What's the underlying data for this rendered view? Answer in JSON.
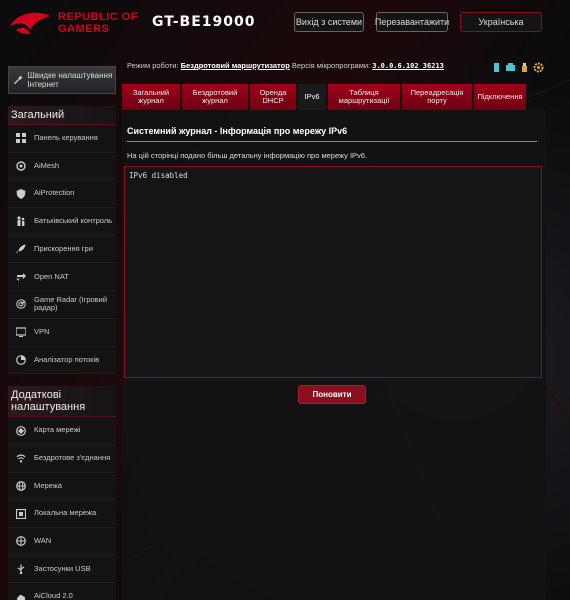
{
  "header": {
    "brand_line1": "REPUBLIC OF",
    "brand_line2": "GAMERS",
    "model": "GT-BE19000",
    "logout_label": "Вихід з системи",
    "reboot_label": "Перезавантажити",
    "language": "Українська"
  },
  "sidebar": {
    "quick_setup": "Швидке налаштування Інтернет",
    "general_title": "Загальний",
    "general_items": [
      {
        "label": "Панель керування",
        "icon": "dashboard-icon"
      },
      {
        "label": "AiMesh",
        "icon": "aimesh-icon"
      },
      {
        "label": "AiProtection",
        "icon": "shield-icon"
      },
      {
        "label": "Батьківський контроль",
        "icon": "parental-icon"
      },
      {
        "label": "Прискорення гри",
        "icon": "rocket-icon"
      },
      {
        "label": "Open NAT",
        "icon": "nat-icon"
      },
      {
        "label": "Game Radar (Ігровий радар)",
        "icon": "radar-icon"
      },
      {
        "label": "VPN",
        "icon": "vpn-icon"
      },
      {
        "label": "Аналізатор потоків",
        "icon": "traffic-icon"
      }
    ],
    "advanced_title": "Додаткові налаштування",
    "advanced_items": [
      {
        "label": "Карта мережі",
        "icon": "network-map-icon"
      },
      {
        "label": "Бездротове з'єднання",
        "icon": "wireless-icon"
      },
      {
        "label": "Мережа",
        "icon": "globe-icon"
      },
      {
        "label": "Локальна мережа",
        "icon": "lan-icon"
      },
      {
        "label": "WAN",
        "icon": "wan-icon"
      },
      {
        "label": "Застосунки USB",
        "icon": "usb-icon"
      },
      {
        "label": "AiCloud 2.0",
        "icon": "cloud-icon"
      }
    ]
  },
  "status": {
    "mode_prefix": "Режим роботи:",
    "mode_value": "Бездротовий маршрутизатор",
    "fw_prefix": "Версія мікропрограми:",
    "fw_value": "3.0.0.6.102_36213"
  },
  "tabs": [
    {
      "label": "Загальний журнал",
      "width": 58
    },
    {
      "label": "Бездротовий журнал",
      "width": 66
    },
    {
      "label": "Оренда DHCP",
      "width": 46
    },
    {
      "label": "IPv6",
      "width": 28,
      "active": true
    },
    {
      "label": "Таблиця маршрутизації",
      "width": 72
    },
    {
      "label": "Переадресація порту",
      "width": 70
    },
    {
      "label": "Підключення",
      "width": 52
    }
  ],
  "content": {
    "title": "Системний журнал - Інформація про мережу IPv6",
    "description": "На цій сторінці подано більш детальну інформацію про мережу IPv6.",
    "log_text": "IPv6 disabled",
    "refresh_label": "Поновити"
  },
  "colors": {
    "accent": "#8a0e1e",
    "brand_red": "#d4001c"
  }
}
